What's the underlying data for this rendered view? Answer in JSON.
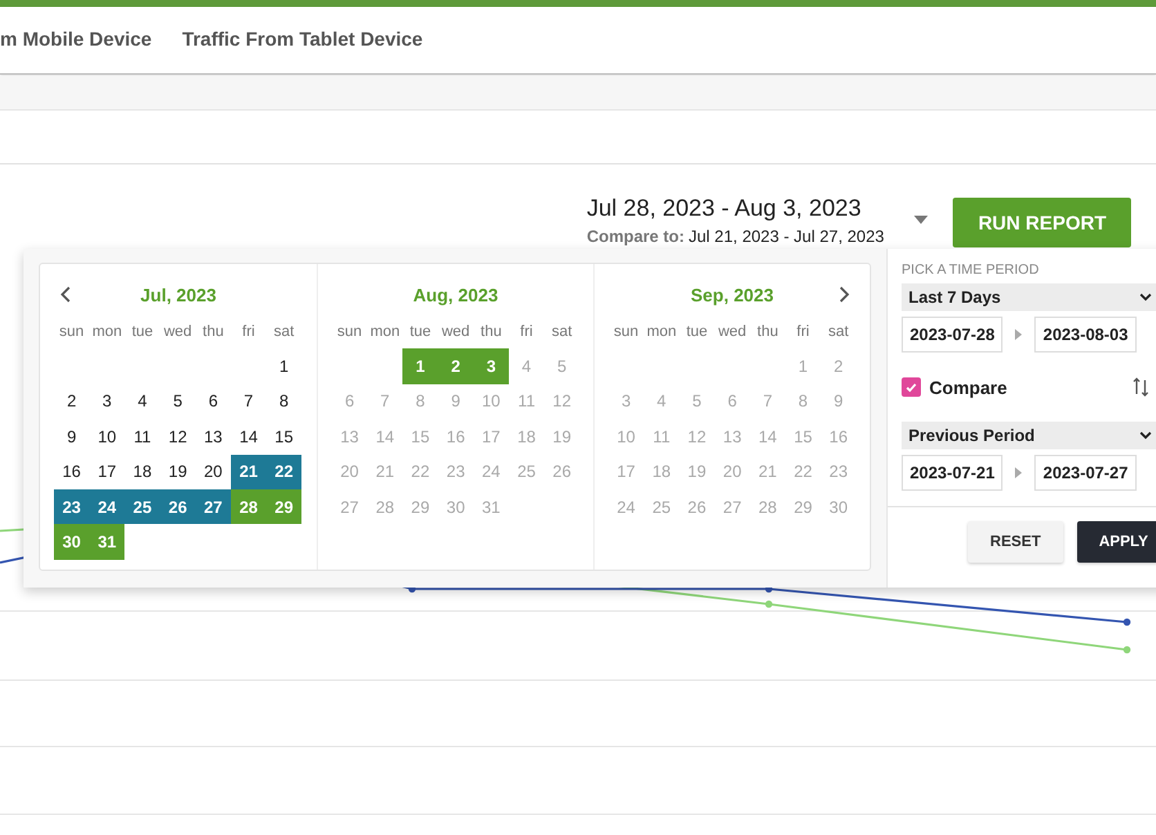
{
  "tabs": [
    {
      "label": "m Mobile Device",
      "selected": false
    },
    {
      "label": "Traffic From Tablet Device",
      "selected": false
    }
  ],
  "date_range": {
    "primary": "Jul 28, 2023 - Aug 3, 2023",
    "compare_label": "Compare to:",
    "compare": "Jul 21, 2023 - Jul 27, 2023"
  },
  "run_report": "RUN REPORT",
  "calendars": [
    {
      "title": "Jul, 2023",
      "weekdays": [
        "sun",
        "mon",
        "tue",
        "wed",
        "thu",
        "fri",
        "sat"
      ],
      "weeks": [
        [
          {
            "kind": "blank"
          },
          {
            "kind": "blank"
          },
          {
            "kind": "blank"
          },
          {
            "kind": "blank"
          },
          {
            "kind": "blank"
          },
          {
            "kind": "blank"
          },
          {
            "kind": "day",
            "day": "1",
            "selected": false,
            "compare": false,
            "disabled": false
          }
        ],
        [
          {
            "kind": "day",
            "day": "2",
            "selected": false,
            "compare": false,
            "disabled": false
          },
          {
            "kind": "day",
            "day": "3",
            "selected": false,
            "compare": false,
            "disabled": false
          },
          {
            "kind": "day",
            "day": "4",
            "selected": false,
            "compare": false,
            "disabled": false
          },
          {
            "kind": "day",
            "day": "5",
            "selected": false,
            "compare": false,
            "disabled": false
          },
          {
            "kind": "day",
            "day": "6",
            "selected": false,
            "compare": false,
            "disabled": false
          },
          {
            "kind": "day",
            "day": "7",
            "selected": false,
            "compare": false,
            "disabled": false
          },
          {
            "kind": "day",
            "day": "8",
            "selected": false,
            "compare": false,
            "disabled": false
          }
        ],
        [
          {
            "kind": "day",
            "day": "9",
            "selected": false,
            "compare": false,
            "disabled": false
          },
          {
            "kind": "day",
            "day": "10",
            "selected": false,
            "compare": false,
            "disabled": false
          },
          {
            "kind": "day",
            "day": "11",
            "selected": false,
            "compare": false,
            "disabled": false
          },
          {
            "kind": "day",
            "day": "12",
            "selected": false,
            "compare": false,
            "disabled": false
          },
          {
            "kind": "day",
            "day": "13",
            "selected": false,
            "compare": false,
            "disabled": false
          },
          {
            "kind": "day",
            "day": "14",
            "selected": false,
            "compare": false,
            "disabled": false
          },
          {
            "kind": "day",
            "day": "15",
            "selected": false,
            "compare": false,
            "disabled": false
          }
        ],
        [
          {
            "kind": "day",
            "day": "16",
            "selected": false,
            "compare": false,
            "disabled": false
          },
          {
            "kind": "day",
            "day": "17",
            "selected": false,
            "compare": false,
            "disabled": false
          },
          {
            "kind": "day",
            "day": "18",
            "selected": false,
            "compare": false,
            "disabled": false
          },
          {
            "kind": "day",
            "day": "19",
            "selected": false,
            "compare": false,
            "disabled": false
          },
          {
            "kind": "day",
            "day": "20",
            "selected": false,
            "compare": false,
            "disabled": false
          },
          {
            "kind": "day",
            "day": "21",
            "selected": false,
            "compare": true,
            "disabled": false
          },
          {
            "kind": "day",
            "day": "22",
            "selected": false,
            "compare": true,
            "disabled": false
          }
        ],
        [
          {
            "kind": "day",
            "day": "23",
            "selected": false,
            "compare": true,
            "disabled": false
          },
          {
            "kind": "day",
            "day": "24",
            "selected": false,
            "compare": true,
            "disabled": false
          },
          {
            "kind": "day",
            "day": "25",
            "selected": false,
            "compare": true,
            "disabled": false
          },
          {
            "kind": "day",
            "day": "26",
            "selected": false,
            "compare": true,
            "disabled": false
          },
          {
            "kind": "day",
            "day": "27",
            "selected": false,
            "compare": true,
            "disabled": false
          },
          {
            "kind": "day",
            "day": "28",
            "selected": true,
            "compare": false,
            "disabled": false
          },
          {
            "kind": "day",
            "day": "29",
            "selected": true,
            "compare": false,
            "disabled": false
          }
        ],
        [
          {
            "kind": "day",
            "day": "30",
            "selected": true,
            "compare": false,
            "disabled": false
          },
          {
            "kind": "day",
            "day": "31",
            "selected": true,
            "compare": false,
            "disabled": false
          }
        ]
      ]
    },
    {
      "title": "Aug, 2023",
      "weekdays": [
        "sun",
        "mon",
        "tue",
        "wed",
        "thu",
        "fri",
        "sat"
      ],
      "weeks": [
        [
          {
            "kind": "blank"
          },
          {
            "kind": "blank"
          },
          {
            "kind": "day",
            "day": "1",
            "selected": true,
            "compare": false,
            "disabled": false
          },
          {
            "kind": "day",
            "day": "2",
            "selected": true,
            "compare": false,
            "disabled": false
          },
          {
            "kind": "day",
            "day": "3",
            "selected": true,
            "compare": false,
            "disabled": false
          },
          {
            "kind": "day",
            "day": "4",
            "selected": false,
            "compare": false,
            "disabled": true
          },
          {
            "kind": "day",
            "day": "5",
            "selected": false,
            "compare": false,
            "disabled": true
          }
        ],
        [
          {
            "kind": "day",
            "day": "6",
            "selected": false,
            "compare": false,
            "disabled": true
          },
          {
            "kind": "day",
            "day": "7",
            "selected": false,
            "compare": false,
            "disabled": true
          },
          {
            "kind": "day",
            "day": "8",
            "selected": false,
            "compare": false,
            "disabled": true
          },
          {
            "kind": "day",
            "day": "9",
            "selected": false,
            "compare": false,
            "disabled": true
          },
          {
            "kind": "day",
            "day": "10",
            "selected": false,
            "compare": false,
            "disabled": true
          },
          {
            "kind": "day",
            "day": "11",
            "selected": false,
            "compare": false,
            "disabled": true
          },
          {
            "kind": "day",
            "day": "12",
            "selected": false,
            "compare": false,
            "disabled": true
          }
        ],
        [
          {
            "kind": "day",
            "day": "13",
            "selected": false,
            "compare": false,
            "disabled": true
          },
          {
            "kind": "day",
            "day": "14",
            "selected": false,
            "compare": false,
            "disabled": true
          },
          {
            "kind": "day",
            "day": "15",
            "selected": false,
            "compare": false,
            "disabled": true
          },
          {
            "kind": "day",
            "day": "16",
            "selected": false,
            "compare": false,
            "disabled": true
          },
          {
            "kind": "day",
            "day": "17",
            "selected": false,
            "compare": false,
            "disabled": true
          },
          {
            "kind": "day",
            "day": "18",
            "selected": false,
            "compare": false,
            "disabled": true
          },
          {
            "kind": "day",
            "day": "19",
            "selected": false,
            "compare": false,
            "disabled": true
          }
        ],
        [
          {
            "kind": "day",
            "day": "20",
            "selected": false,
            "compare": false,
            "disabled": true
          },
          {
            "kind": "day",
            "day": "21",
            "selected": false,
            "compare": false,
            "disabled": true
          },
          {
            "kind": "day",
            "day": "22",
            "selected": false,
            "compare": false,
            "disabled": true
          },
          {
            "kind": "day",
            "day": "23",
            "selected": false,
            "compare": false,
            "disabled": true
          },
          {
            "kind": "day",
            "day": "24",
            "selected": false,
            "compare": false,
            "disabled": true
          },
          {
            "kind": "day",
            "day": "25",
            "selected": false,
            "compare": false,
            "disabled": true
          },
          {
            "kind": "day",
            "day": "26",
            "selected": false,
            "compare": false,
            "disabled": true
          }
        ],
        [
          {
            "kind": "day",
            "day": "27",
            "selected": false,
            "compare": false,
            "disabled": true
          },
          {
            "kind": "day",
            "day": "28",
            "selected": false,
            "compare": false,
            "disabled": true
          },
          {
            "kind": "day",
            "day": "29",
            "selected": false,
            "compare": false,
            "disabled": true
          },
          {
            "kind": "day",
            "day": "30",
            "selected": false,
            "compare": false,
            "disabled": true
          },
          {
            "kind": "day",
            "day": "31",
            "selected": false,
            "compare": false,
            "disabled": true
          }
        ]
      ]
    },
    {
      "title": "Sep, 2023",
      "weekdays": [
        "sun",
        "mon",
        "tue",
        "wed",
        "thu",
        "fri",
        "sat"
      ],
      "weeks": [
        [
          {
            "kind": "blank"
          },
          {
            "kind": "blank"
          },
          {
            "kind": "blank"
          },
          {
            "kind": "blank"
          },
          {
            "kind": "blank"
          },
          {
            "kind": "day",
            "day": "1",
            "selected": false,
            "compare": false,
            "disabled": true
          },
          {
            "kind": "day",
            "day": "2",
            "selected": false,
            "compare": false,
            "disabled": true
          }
        ],
        [
          {
            "kind": "day",
            "day": "3",
            "selected": false,
            "compare": false,
            "disabled": true
          },
          {
            "kind": "day",
            "day": "4",
            "selected": false,
            "compare": false,
            "disabled": true
          },
          {
            "kind": "day",
            "day": "5",
            "selected": false,
            "compare": false,
            "disabled": true
          },
          {
            "kind": "day",
            "day": "6",
            "selected": false,
            "compare": false,
            "disabled": true
          },
          {
            "kind": "day",
            "day": "7",
            "selected": false,
            "compare": false,
            "disabled": true
          },
          {
            "kind": "day",
            "day": "8",
            "selected": false,
            "compare": false,
            "disabled": true
          },
          {
            "kind": "day",
            "day": "9",
            "selected": false,
            "compare": false,
            "disabled": true
          }
        ],
        [
          {
            "kind": "day",
            "day": "10",
            "selected": false,
            "compare": false,
            "disabled": true
          },
          {
            "kind": "day",
            "day": "11",
            "selected": false,
            "compare": false,
            "disabled": true
          },
          {
            "kind": "day",
            "day": "12",
            "selected": false,
            "compare": false,
            "disabled": true
          },
          {
            "kind": "day",
            "day": "13",
            "selected": false,
            "compare": false,
            "disabled": true
          },
          {
            "kind": "day",
            "day": "14",
            "selected": false,
            "compare": false,
            "disabled": true
          },
          {
            "kind": "day",
            "day": "15",
            "selected": false,
            "compare": false,
            "disabled": true
          },
          {
            "kind": "day",
            "day": "16",
            "selected": false,
            "compare": false,
            "disabled": true
          }
        ],
        [
          {
            "kind": "day",
            "day": "17",
            "selected": false,
            "compare": false,
            "disabled": true
          },
          {
            "kind": "day",
            "day": "18",
            "selected": false,
            "compare": false,
            "disabled": true
          },
          {
            "kind": "day",
            "day": "19",
            "selected": false,
            "compare": false,
            "disabled": true
          },
          {
            "kind": "day",
            "day": "20",
            "selected": false,
            "compare": false,
            "disabled": true
          },
          {
            "kind": "day",
            "day": "21",
            "selected": false,
            "compare": false,
            "disabled": true
          },
          {
            "kind": "day",
            "day": "22",
            "selected": false,
            "compare": false,
            "disabled": true
          },
          {
            "kind": "day",
            "day": "23",
            "selected": false,
            "compare": false,
            "disabled": true
          }
        ],
        [
          {
            "kind": "day",
            "day": "24",
            "selected": false,
            "compare": false,
            "disabled": true
          },
          {
            "kind": "day",
            "day": "25",
            "selected": false,
            "compare": false,
            "disabled": true
          },
          {
            "kind": "day",
            "day": "26",
            "selected": false,
            "compare": false,
            "disabled": true
          },
          {
            "kind": "day",
            "day": "27",
            "selected": false,
            "compare": false,
            "disabled": true
          },
          {
            "kind": "day",
            "day": "28",
            "selected": false,
            "compare": false,
            "disabled": true
          },
          {
            "kind": "day",
            "day": "29",
            "selected": false,
            "compare": false,
            "disabled": true
          },
          {
            "kind": "day",
            "day": "30",
            "selected": false,
            "compare": false,
            "disabled": true
          }
        ]
      ]
    }
  ],
  "panel": {
    "heading": "PICK A TIME PERIOD",
    "period": "Last 7 Days",
    "start": "2023-07-28",
    "end": "2023-08-03",
    "compare": {
      "label": "Compare",
      "checked": true
    },
    "compare_period": "Previous Period",
    "compare_start": "2023-07-21",
    "compare_end": "2023-07-27",
    "buttons": [
      {
        "label": "RESET",
        "kind": "secondary"
      },
      {
        "label": "APPLY",
        "kind": "primary"
      }
    ]
  }
}
